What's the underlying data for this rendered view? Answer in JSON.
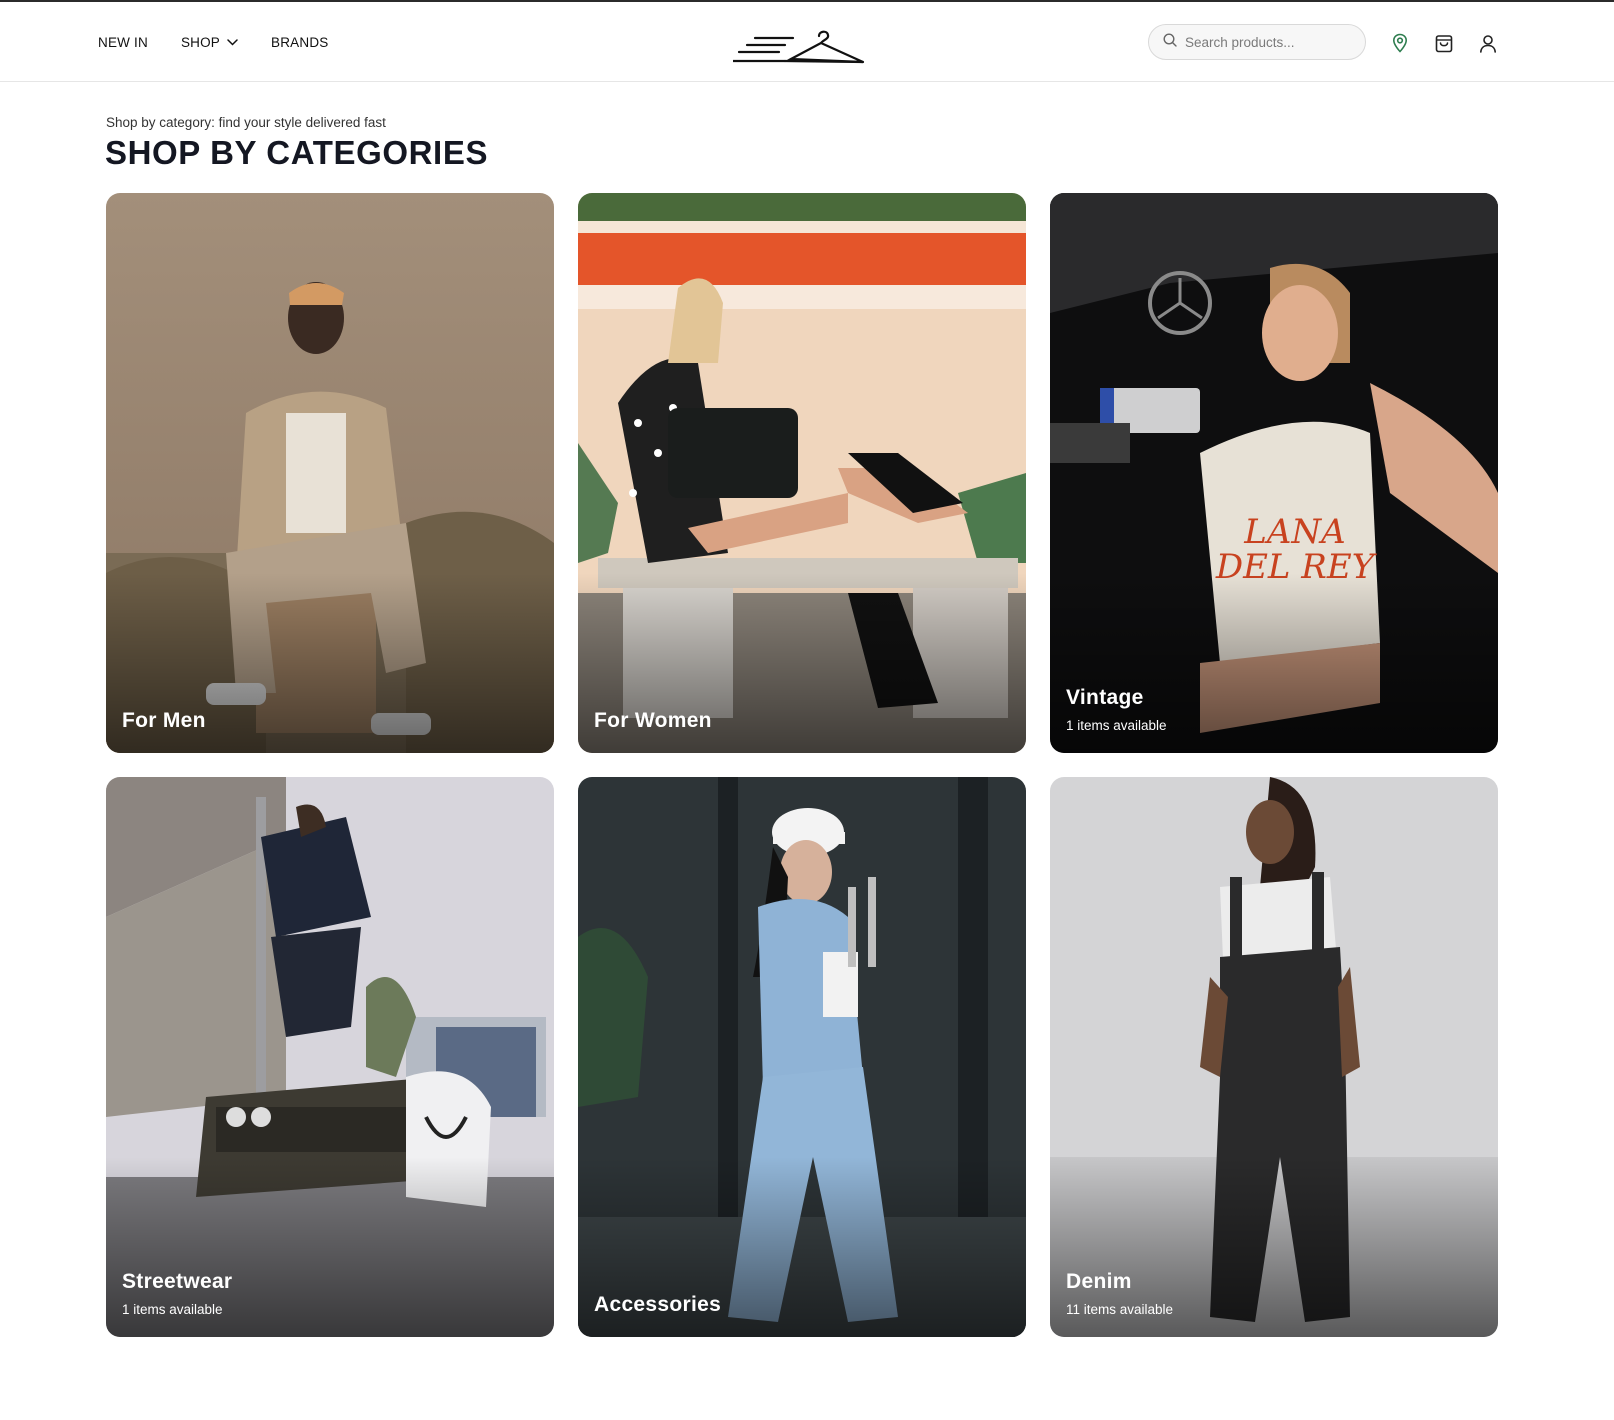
{
  "nav": {
    "items": [
      {
        "label": "NEW IN"
      },
      {
        "label": "SHOP",
        "has_dropdown": true
      },
      {
        "label": "BRANDS"
      }
    ]
  },
  "search": {
    "placeholder": "Search products..."
  },
  "header_icons": [
    "location-pin-icon",
    "shopping-bag-icon",
    "user-icon"
  ],
  "colors": {
    "accent_green": "#2e7d4f",
    "title": "#141722"
  },
  "hero": {
    "eyebrow": "Shop by category: find your style delivered fast",
    "title": "SHOP BY CATEGORIES"
  },
  "categories": [
    {
      "name": "For Men",
      "count": ""
    },
    {
      "name": "For Women",
      "count": ""
    },
    {
      "name": "Vintage",
      "count": "1 items available"
    },
    {
      "name": "Streetwear",
      "count": "1 items available"
    },
    {
      "name": "Accessories",
      "count": ""
    },
    {
      "name": "Denim",
      "count": "11 items available"
    }
  ]
}
